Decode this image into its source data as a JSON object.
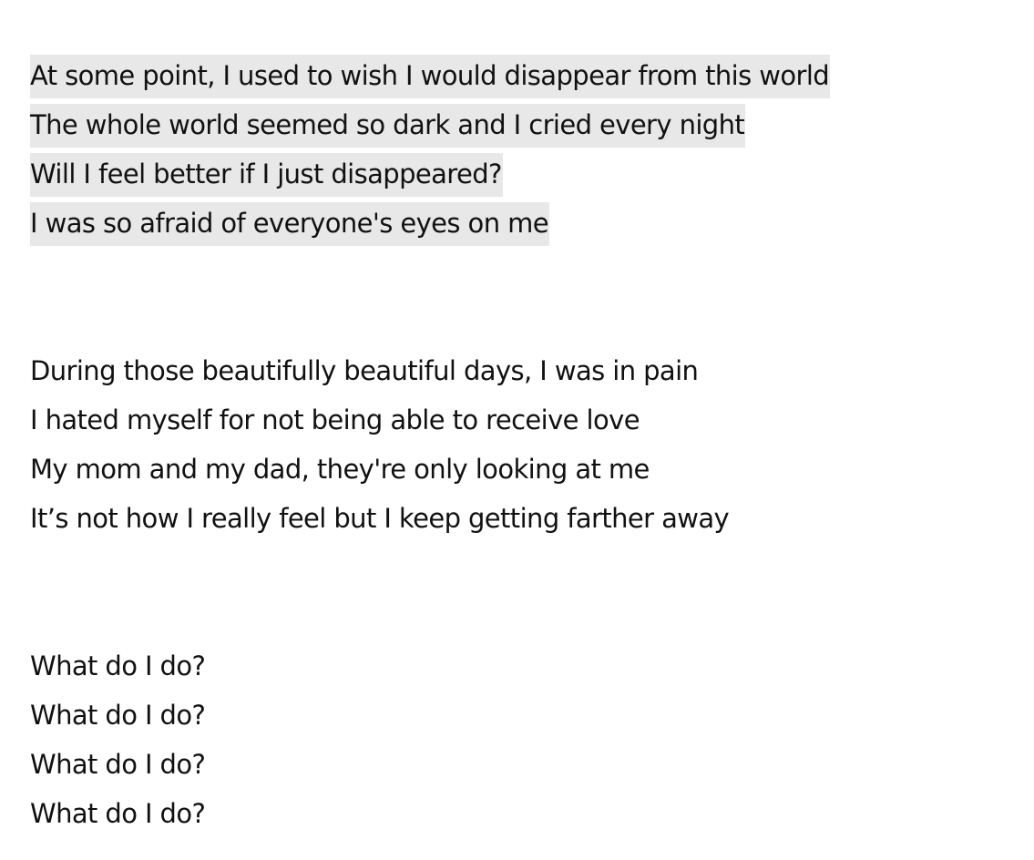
{
  "stanzas": [
    {
      "highlighted": true,
      "lines": [
        "At some point, I used to wish I would disappear from this world",
        "The whole world seemed so dark and I cried every night",
        "Will I feel better if I just disappeared?",
        "I was so afraid of everyone's eyes on me"
      ]
    },
    {
      "highlighted": false,
      "lines": [
        "During those beautifully beautiful days, I was in pain",
        "I hated myself for not being able to receive love",
        "My mom and my dad, they're only looking at me",
        "It’s not how I really feel but I keep getting farther away"
      ]
    },
    {
      "highlighted": false,
      "lines": [
        "What do I do?",
        "What do I do?",
        "What do I do?",
        "What do I do?"
      ]
    }
  ],
  "colors": {
    "highlight": "#e8e8e8",
    "text": "#111111",
    "background": "#ffffff"
  }
}
